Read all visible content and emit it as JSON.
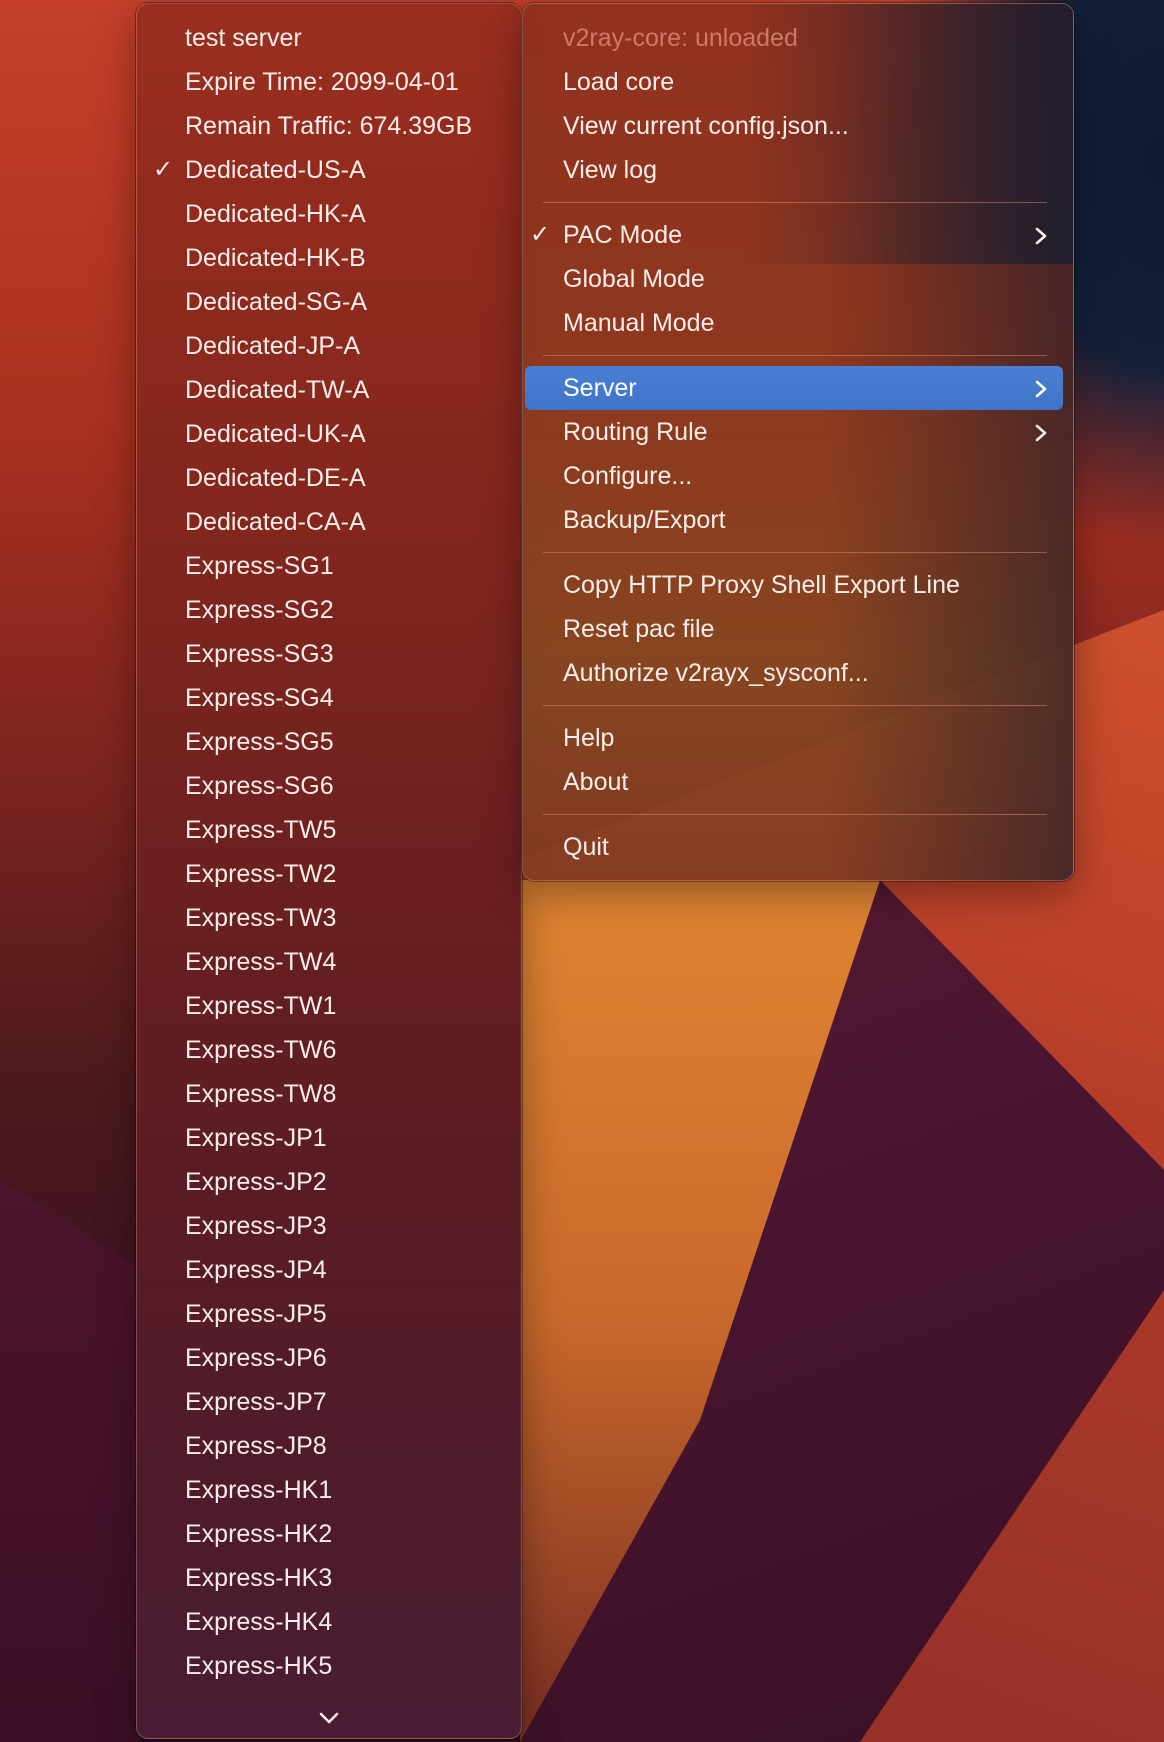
{
  "colors": {
    "highlight": "#4479cc",
    "menu_text": "#fbeeea",
    "disabled_text": "#e6968285"
  },
  "server_menu": {
    "info": [
      "test server",
      "Expire Time: 2099-04-01",
      "Remain Traffic: 674.39GB"
    ],
    "servers": [
      {
        "label": "Dedicated-US-A",
        "checked": true
      },
      {
        "label": "Dedicated-HK-A"
      },
      {
        "label": "Dedicated-HK-B"
      },
      {
        "label": "Dedicated-SG-A"
      },
      {
        "label": "Dedicated-JP-A"
      },
      {
        "label": "Dedicated-TW-A"
      },
      {
        "label": "Dedicated-UK-A"
      },
      {
        "label": "Dedicated-DE-A"
      },
      {
        "label": "Dedicated-CA-A"
      },
      {
        "label": "Express-SG1"
      },
      {
        "label": "Express-SG2"
      },
      {
        "label": "Express-SG3"
      },
      {
        "label": "Express-SG4"
      },
      {
        "label": "Express-SG5"
      },
      {
        "label": "Express-SG6"
      },
      {
        "label": "Express-TW5"
      },
      {
        "label": "Express-TW2"
      },
      {
        "label": "Express-TW3"
      },
      {
        "label": "Express-TW4"
      },
      {
        "label": "Express-TW1"
      },
      {
        "label": "Express-TW6"
      },
      {
        "label": "Express-TW8"
      },
      {
        "label": "Express-JP1"
      },
      {
        "label": "Express-JP2"
      },
      {
        "label": "Express-JP3"
      },
      {
        "label": "Express-JP4"
      },
      {
        "label": "Express-JP5"
      },
      {
        "label": "Express-JP6"
      },
      {
        "label": "Express-JP7"
      },
      {
        "label": "Express-JP8"
      },
      {
        "label": "Express-HK1"
      },
      {
        "label": "Express-HK2"
      },
      {
        "label": "Express-HK3"
      },
      {
        "label": "Express-HK4"
      },
      {
        "label": "Express-HK5"
      }
    ],
    "check_glyph": "✓",
    "scroll_icon": "chevron-down-icon"
  },
  "main_menu": {
    "core_status": "v2ray-core: unloaded",
    "load_core": "Load core",
    "view_config": "View current config.json...",
    "view_log": "View log",
    "pac_mode": "PAC Mode",
    "pac_mode_checked": true,
    "global_mode": "Global Mode",
    "manual_mode": "Manual Mode",
    "server": "Server",
    "routing_rule": "Routing Rule",
    "configure": "Configure...",
    "backup_export": "Backup/Export",
    "copy_http_proxy": "Copy HTTP Proxy Shell Export Line",
    "reset_pac": "Reset pac file",
    "authorize": "Authorize v2rayx_sysconf...",
    "help": "Help",
    "about": "About",
    "quit": "Quit",
    "check_glyph": "✓"
  }
}
